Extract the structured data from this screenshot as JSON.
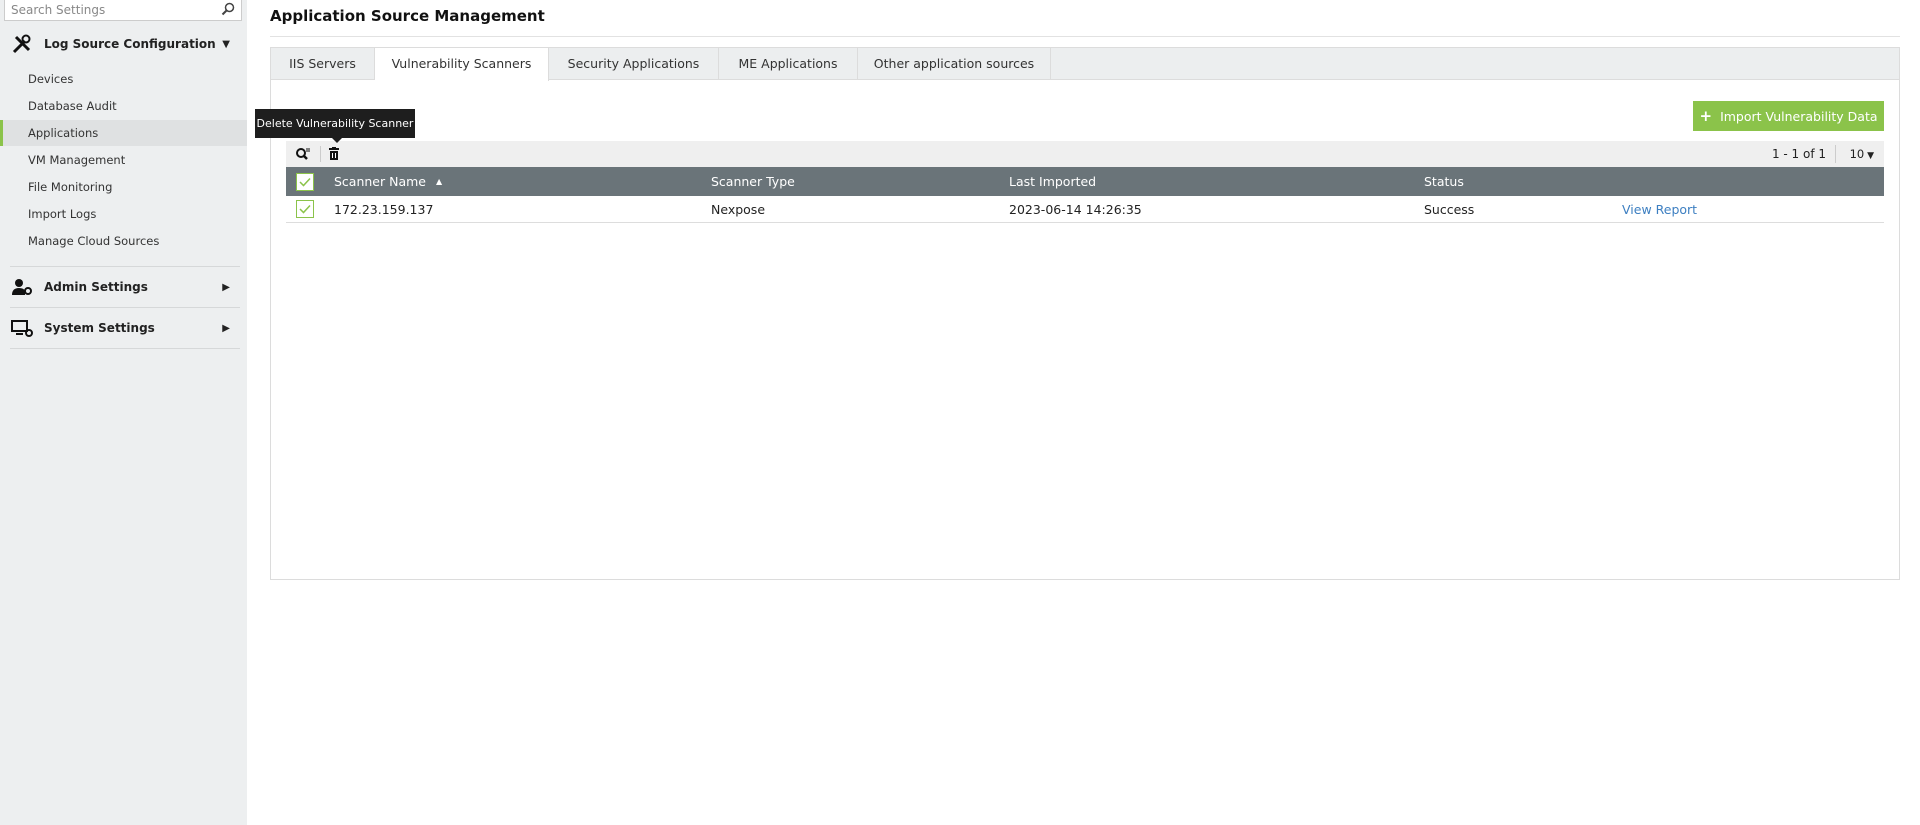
{
  "sidebar": {
    "search_placeholder": "Search Settings",
    "log_source": {
      "label": "Log Source Configuration",
      "items": [
        "Devices",
        "Database Audit",
        "Applications",
        "VM Management",
        "File Monitoring",
        "Import Logs",
        "Manage Cloud Sources"
      ],
      "active": "Applications"
    },
    "admin": {
      "label": "Admin Settings"
    },
    "system": {
      "label": "System Settings"
    }
  },
  "main": {
    "title": "Application Source Management",
    "tabs": [
      "IIS Servers",
      "Vulnerability Scanners",
      "Security Applications",
      "ME Applications",
      "Other application sources"
    ],
    "active_tab": "Vulnerability Scanners",
    "import_button": "Import Vulnerability Data",
    "tooltip": "Delete Vulnerability Scanner",
    "pagination": "1 - 1 of 1",
    "page_size": "10",
    "columns": [
      "Scanner Name",
      "Scanner Type",
      "Last Imported",
      "Status"
    ],
    "rows": [
      {
        "name": "172.23.159.137",
        "type": "Nexpose",
        "last_imported": "2023-06-14 14:26:35",
        "status": "Success",
        "action": "View Report"
      }
    ]
  },
  "colors": {
    "accent": "#8bc34a",
    "header": "#6a7479",
    "link": "#3d7fc1"
  }
}
